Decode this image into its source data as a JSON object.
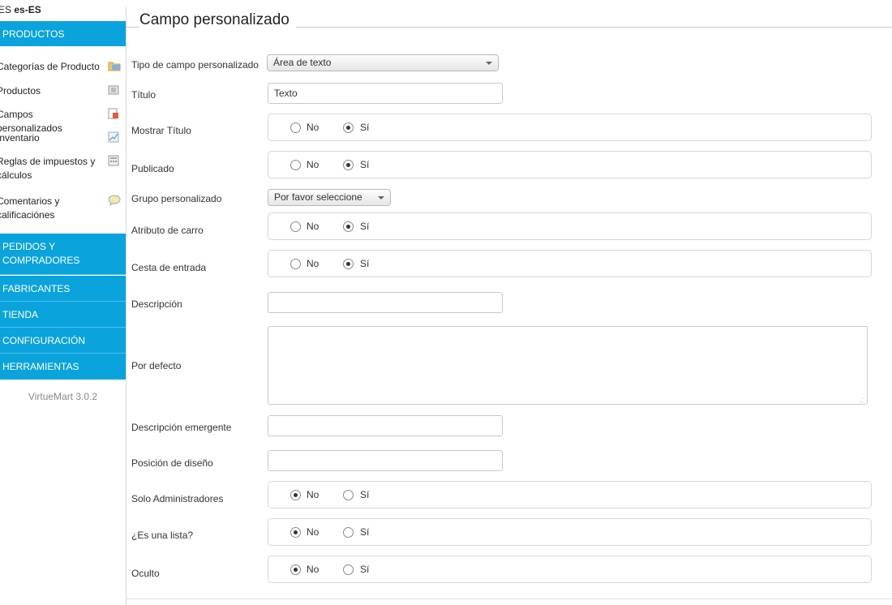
{
  "sidebar": {
    "lang": {
      "prefix": "ES ",
      "code": "es-ES"
    },
    "sections": {
      "products": "PRODUCTOS",
      "orders_1": "PEDIDOS Y",
      "orders_2": "COMPRADORES",
      "manufacturers": "FABRICANTES",
      "shop": "TIENDA",
      "config": "CONFIGURACIÓN",
      "tools": "HERRAMIENTAS"
    },
    "items": [
      {
        "label": "Categorías de Producto",
        "icon": "folder-icon"
      },
      {
        "label": "Productos",
        "icon": "product-icon"
      },
      {
        "label": "Campos personalizados",
        "icon": "custom-fields-icon"
      },
      {
        "label": "Inventario",
        "icon": "chart-icon"
      },
      {
        "label": "Reglas de impuestos y cálculos",
        "icon": "calculator-icon"
      },
      {
        "label": "Comentarios y calificaciónes",
        "icon": "comment-icon"
      }
    ],
    "version": "VirtueMart 3.0.2"
  },
  "form": {
    "legend": "Campo personalizado",
    "type": {
      "label": "Tipo de campo personalizado",
      "value": "Área de texto"
    },
    "title": {
      "label": "Título",
      "value": "Texto"
    },
    "show_title": {
      "label": "Mostrar Título",
      "selected": "Sí"
    },
    "published": {
      "label": "Publicado",
      "selected": "Sí"
    },
    "group": {
      "label": "Grupo personalizado",
      "value": "Por favor seleccione"
    },
    "cart_attr": {
      "label": "Atributo de carro",
      "selected": "Sí"
    },
    "cart_input": {
      "label": "Cesta de entrada",
      "selected": "Sí"
    },
    "description": {
      "label": "Descripción",
      "value": ""
    },
    "default": {
      "label": "Por defecto",
      "value": ""
    },
    "tooltip": {
      "label": "Descripción emergente",
      "value": ""
    },
    "layout_pos": {
      "label": "Posición de diseño",
      "value": ""
    },
    "admin_only": {
      "label": "Solo Administradores",
      "selected": "No"
    },
    "is_list": {
      "label": "¿Es una lista?",
      "selected": "No"
    },
    "hidden": {
      "label": "Oculto",
      "selected": "No"
    },
    "opt_no": "No",
    "opt_yes": "Sí"
  },
  "colors": {
    "accent": "#0ba3dc"
  }
}
